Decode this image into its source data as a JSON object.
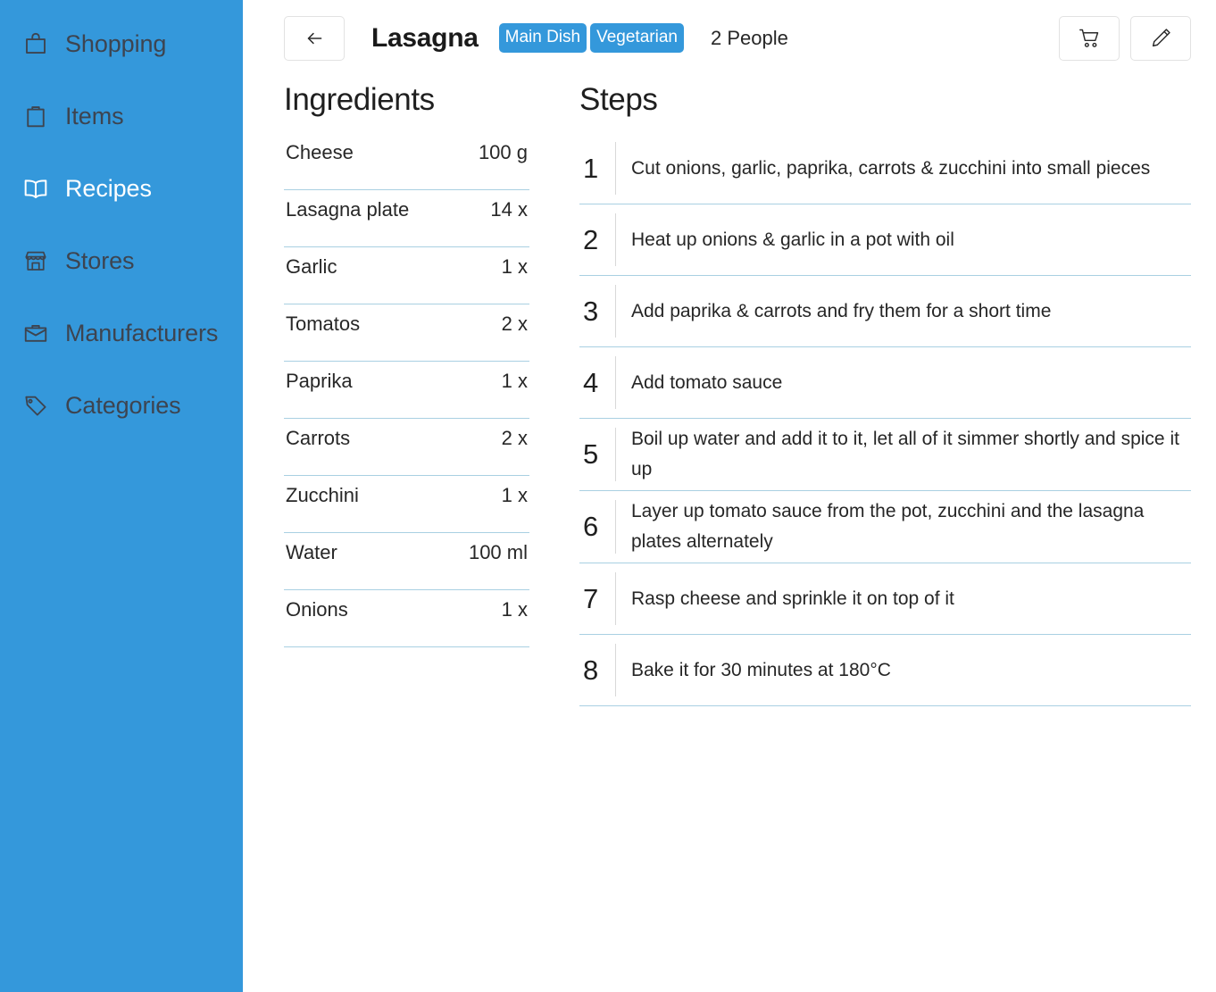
{
  "sidebar": {
    "items": [
      {
        "label": "Shopping",
        "icon": "shopping-bag-icon",
        "active": false
      },
      {
        "label": "Items",
        "icon": "clipboard-icon",
        "active": false
      },
      {
        "label": "Recipes",
        "icon": "book-icon",
        "active": true
      },
      {
        "label": "Stores",
        "icon": "store-icon",
        "active": false
      },
      {
        "label": "Manufacturers",
        "icon": "briefcase-icon",
        "active": false
      },
      {
        "label": "Categories",
        "icon": "tag-icon",
        "active": false
      }
    ],
    "background_color": "#3498db",
    "inactive_text_color": "#3d4450",
    "active_text_color": "#ffffff"
  },
  "header": {
    "back_label": "←",
    "title": "Lasagna",
    "tags": [
      "Main Dish",
      "Vegetarian"
    ],
    "servings": "2 People",
    "tag_color": "#3498db",
    "actions": [
      {
        "name": "cart-button",
        "icon": "shopping-cart-icon"
      },
      {
        "name": "edit-button",
        "icon": "pencil-icon"
      }
    ]
  },
  "ingredients": {
    "title": "Ingredients",
    "items": [
      {
        "name": "Cheese",
        "qty": "100 g"
      },
      {
        "name": "Lasagna plate",
        "qty": "14 x"
      },
      {
        "name": "Garlic",
        "qty": "1 x"
      },
      {
        "name": "Tomatos",
        "qty": "2 x"
      },
      {
        "name": "Paprika",
        "qty": "1 x"
      },
      {
        "name": "Carrots",
        "qty": "2 x"
      },
      {
        "name": "Zucchini",
        "qty": "1 x"
      },
      {
        "name": "Water",
        "qty": "100 ml"
      },
      {
        "name": "Onions",
        "qty": "1 x"
      }
    ]
  },
  "steps": {
    "title": "Steps",
    "items": [
      {
        "num": "1",
        "text": "Cut onions, garlic, paprika, carrots & zucchini into small pieces"
      },
      {
        "num": "2",
        "text": "Heat up onions & garlic in a pot with oil"
      },
      {
        "num": "3",
        "text": "Add paprika & carrots and fry them for a short time"
      },
      {
        "num": "4",
        "text": "Add tomato sauce"
      },
      {
        "num": "5",
        "text": "Boil up water and add it to it, let all of it simmer shortly and spice it up"
      },
      {
        "num": "6",
        "text": "Layer up tomato sauce from the pot, zucchini and the lasagna plates alternately"
      },
      {
        "num": "7",
        "text": "Rasp cheese and sprinkle it on top of it"
      },
      {
        "num": "8",
        "text": "Bake it for 30 minutes at 180°C"
      }
    ]
  },
  "colors": {
    "divider": "#a9d0e2",
    "accent": "#3498db",
    "text": "#262626"
  }
}
